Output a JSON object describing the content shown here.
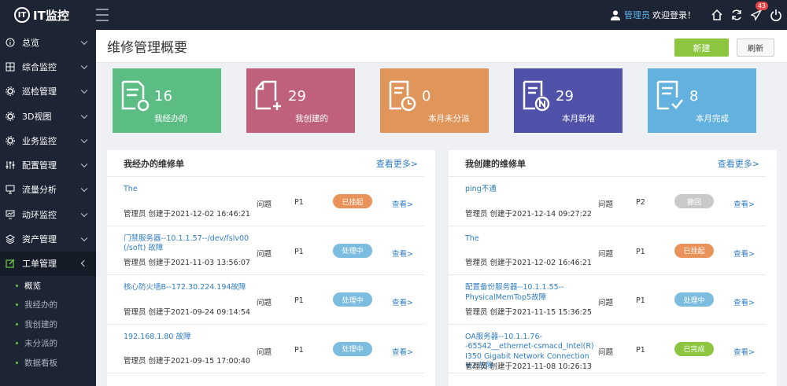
{
  "brand": {
    "name": "IT监控",
    "logo_text": "IT"
  },
  "header": {
    "user_name": "管理员",
    "welcome": "欢迎登录！",
    "badge_count": "43"
  },
  "sidebar": {
    "items": [
      {
        "label": "总览",
        "icon": "info-circle-icon"
      },
      {
        "label": "综合监控",
        "icon": "monitor-grid-icon"
      },
      {
        "label": "巡检管理",
        "icon": "gear-icon"
      },
      {
        "label": "3D视图",
        "icon": "cube-icon"
      },
      {
        "label": "业务监控",
        "icon": "cogs-icon"
      },
      {
        "label": "配置管理",
        "icon": "sliders-icon"
      },
      {
        "label": "流量分析",
        "icon": "screen-icon"
      },
      {
        "label": "动环监控",
        "icon": "screen-chart-icon"
      },
      {
        "label": "资产管理",
        "icon": "layers-icon"
      },
      {
        "label": "工单管理",
        "icon": "edit-icon"
      }
    ],
    "sub_items": [
      "概览",
      "我经办的",
      "我创建的",
      "未分派的",
      "数据看板"
    ]
  },
  "page": {
    "title": "维修管理概要",
    "new_label": "新建",
    "refresh_label": "刷新"
  },
  "cards": [
    {
      "num": "16",
      "label": "我经办的",
      "color": "#5cbd84"
    },
    {
      "num": "29",
      "label": "我创建的",
      "color": "#c0617c"
    },
    {
      "num": "0",
      "label": "本月未分派",
      "color": "#e0955b"
    },
    {
      "num": "29",
      "label": "本月新增",
      "color": "#4f52a8"
    },
    {
      "num": "8",
      "label": "本月完成",
      "color": "#63b1de"
    }
  ],
  "colors": {
    "orange": "#e9935a",
    "blue": "#7cbcdf",
    "gray": "#c9c9c9",
    "green": "#8cc63f"
  },
  "left_panel": {
    "title": "我经办的维修单",
    "more": "查看更多>",
    "rows": [
      {
        "title": "The",
        "meta": "管理员  创建于2021-12-02 16:46:21",
        "type": "问题",
        "prio": "P1",
        "status": "已挂起",
        "status_color": "#e9935a",
        "view": "查看>"
      },
      {
        "title": "门禁服务器--10.1.1.57--/dev/fslv00 (/soft) 故障",
        "meta": "管理员  创建于2021-11-03 13:56:07",
        "type": "问题",
        "prio": "P1",
        "status": "处理中",
        "status_color": "#7cbcdf",
        "view": "查看>"
      },
      {
        "title": "核心防火墙B--172.30.224.194故障",
        "meta": "管理员  创建于2021-09-24 09:14:54",
        "type": "问题",
        "prio": "P1",
        "status": "处理中",
        "status_color": "#7cbcdf",
        "view": "查看>"
      },
      {
        "title": "192.168.1.80 故障",
        "meta": "管理员  创建于2021-09-15 17:00:40",
        "type": "问题",
        "prio": "P1",
        "status": "处理中",
        "status_color": "#7cbcdf",
        "view": "查看>"
      }
    ]
  },
  "right_panel": {
    "title": "我创建的维修单",
    "more": "查看更多>",
    "rows": [
      {
        "title": "ping不通",
        "meta": "管理员  创建于2021-12-14 09:27:22",
        "type": "问题",
        "prio": "P2",
        "status": "撤回",
        "status_color": "#c9c9c9",
        "view": "查看>"
      },
      {
        "title": "The",
        "meta": "管理员  创建于2021-12-02 16:46:21",
        "type": "问题",
        "prio": "P1",
        "status": "已挂起",
        "status_color": "#e9935a",
        "view": "查看>"
      },
      {
        "title": "配置备份服务器--10.1.1.55--PhysicalMemTop5故障",
        "meta": "管理员  创建于2021-11-15 15:36:25",
        "type": "问题",
        "prio": "P1",
        "status": "处理中",
        "status_color": "#7cbcdf",
        "view": "查看>"
      },
      {
        "title": "OA服务器--10.1.1.76--65542__ethernet-csmacd_Intel(R) I350 Gigabit Network Connection #2 故障",
        "meta": "管理员  创建于2021-11-08 10:26:13",
        "type": "问题",
        "prio": "P1",
        "status": "已完成",
        "status_color": "#8cc63f",
        "view": "查看>"
      }
    ]
  }
}
